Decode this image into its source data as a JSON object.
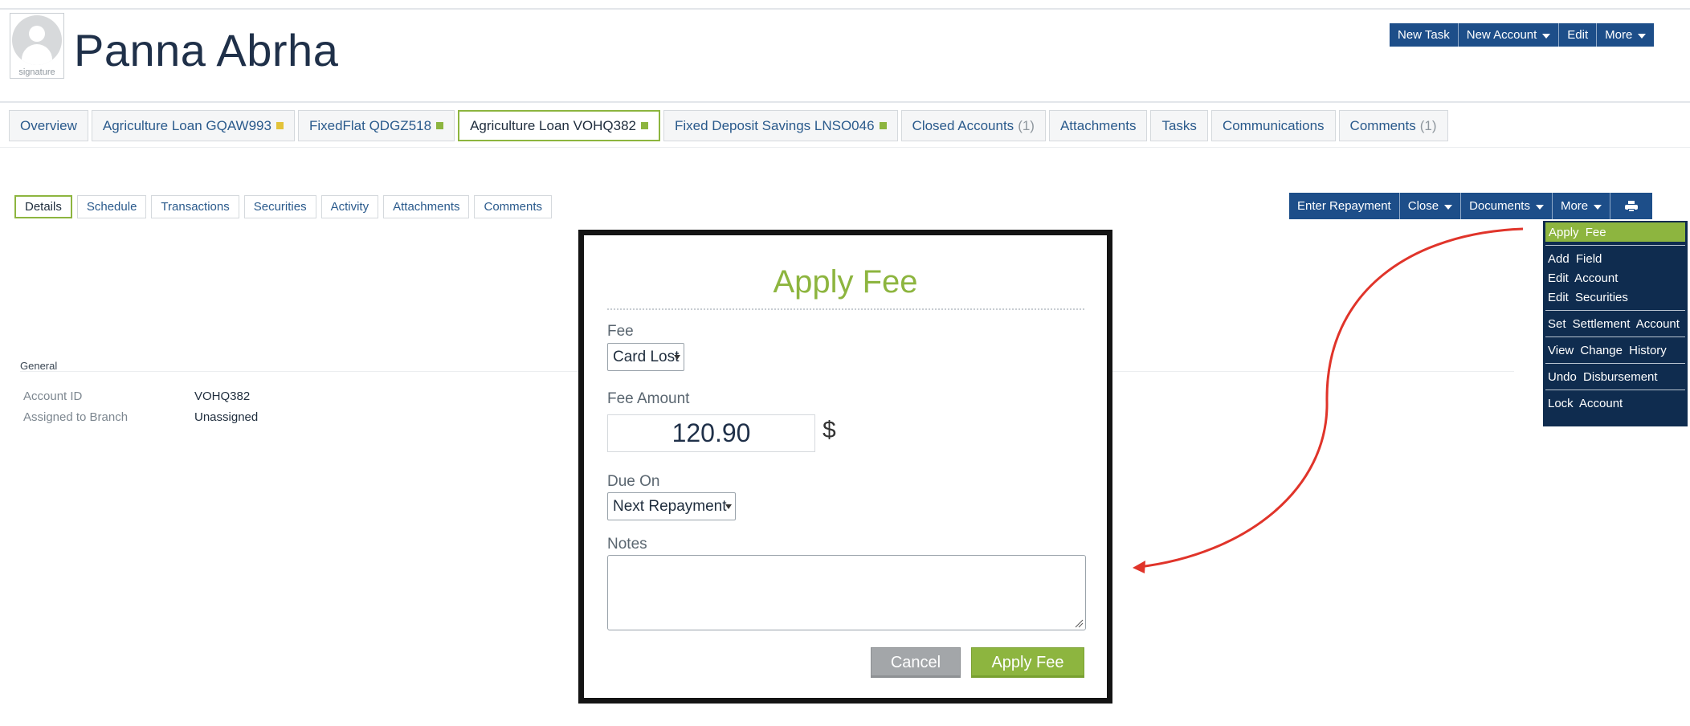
{
  "client": {
    "name": "Panna Abrha",
    "avatar_caption": "signature"
  },
  "header_actions": [
    {
      "label": "New Task",
      "has_caret": false
    },
    {
      "label": "New Account",
      "has_caret": true
    },
    {
      "label": "Edit",
      "has_caret": false
    },
    {
      "label": "More",
      "has_caret": true
    }
  ],
  "main_tabs": [
    {
      "label": "Overview"
    },
    {
      "label": "Agriculture Loan GQAW993",
      "dot_color": "#e3c33a"
    },
    {
      "label": "FixedFlat QDGZ518",
      "dot_color": "#8db53f"
    },
    {
      "label": "Agriculture Loan VOHQ382",
      "dot_color": "#8db53f",
      "active": true
    },
    {
      "label": "Fixed Deposit Savings LNSO046",
      "dot_color": "#8db53f"
    },
    {
      "label": "Closed Accounts",
      "count": "(1)"
    },
    {
      "label": "Attachments"
    },
    {
      "label": "Tasks"
    },
    {
      "label": "Communications"
    },
    {
      "label": "Comments",
      "count": "(1)"
    }
  ],
  "sub_tabs": [
    {
      "label": "Details",
      "active": true
    },
    {
      "label": "Schedule"
    },
    {
      "label": "Transactions"
    },
    {
      "label": "Securities"
    },
    {
      "label": "Activity"
    },
    {
      "label": "Attachments"
    },
    {
      "label": "Comments"
    }
  ],
  "account_actions": [
    {
      "label": "Enter Repayment",
      "has_caret": false
    },
    {
      "label": "Close",
      "has_caret": true
    },
    {
      "label": "Documents",
      "has_caret": true
    },
    {
      "label": "More",
      "has_caret": true
    },
    {
      "icon": "print-icon"
    }
  ],
  "more_menu": [
    {
      "label": "Apply Fee",
      "active": true
    },
    {
      "separator": true
    },
    {
      "label": "Add Field"
    },
    {
      "label": "Edit Account"
    },
    {
      "label": "Edit Securities"
    },
    {
      "separator": true
    },
    {
      "label": "Set Settlement Account"
    },
    {
      "separator": true
    },
    {
      "label": "View Change History"
    },
    {
      "separator": true
    },
    {
      "label": "Undo Disbursement"
    },
    {
      "separator": true
    },
    {
      "label": "Lock Account"
    }
  ],
  "general": {
    "title": "General",
    "rows": [
      {
        "label": "Account ID",
        "value": "VOHQ382"
      },
      {
        "label": "Assigned to Branch",
        "value": "Unassigned"
      }
    ]
  },
  "modal": {
    "title": "Apply Fee",
    "fee_label": "Fee",
    "fee_value": "Card Lost",
    "amount_label": "Fee Amount",
    "amount_value": "120.90",
    "currency": "$",
    "due_label": "Due On",
    "due_value": "Next Repayment",
    "notes_label": "Notes",
    "notes_value": "",
    "cancel_label": "Cancel",
    "apply_label": "Apply Fee"
  },
  "colors": {
    "accent_green": "#8db53f",
    "nav_blue": "#1d4e89",
    "menu_navy": "#0f2c4f",
    "annotation_red": "#e0342a"
  }
}
